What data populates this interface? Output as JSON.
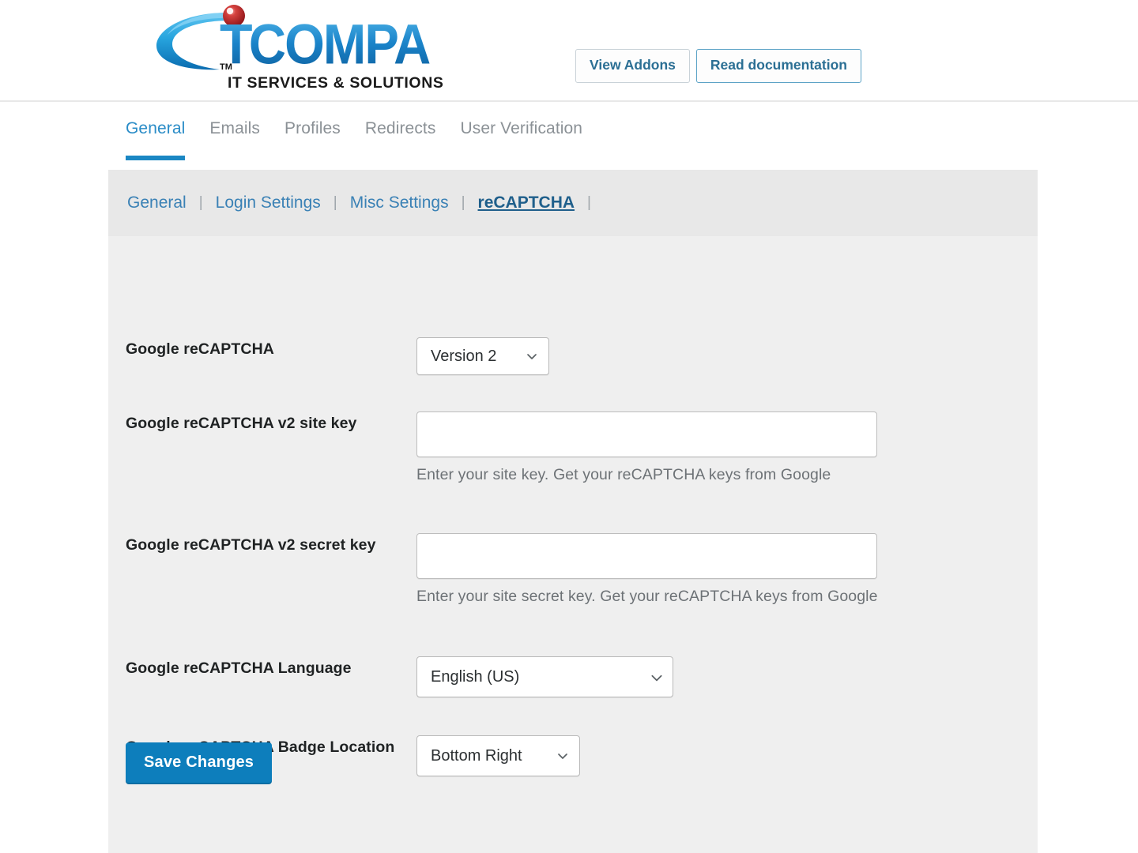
{
  "header": {
    "logo": {
      "name": "IT COMPANY",
      "letter_i": "I",
      "word_t": "T",
      "word_company": "COMPANY",
      "trademark": "TM",
      "tagline": "IT SERVICES & SOLUTIONS",
      "swoosh_color": "#1f9ad6",
      "sphere_color": "#c1272d",
      "text_color": "#1475bb"
    },
    "buttons": [
      {
        "label": "View Addons",
        "style": "gray"
      },
      {
        "label": "Read documentation",
        "style": "blue"
      }
    ]
  },
  "tabs": [
    {
      "label": "General",
      "active": true
    },
    {
      "label": "Emails",
      "active": false
    },
    {
      "label": "Profiles",
      "active": false
    },
    {
      "label": "Redirects",
      "active": false
    },
    {
      "label": "User Verification",
      "active": false
    }
  ],
  "subnav": {
    "items": [
      {
        "label": "General",
        "active": false
      },
      {
        "label": "Login Settings",
        "active": false
      },
      {
        "label": "Misc Settings",
        "active": false
      },
      {
        "label": "reCAPTCHA",
        "active": true
      }
    ],
    "separator": "|"
  },
  "form": {
    "recaptcha_version": {
      "label": "Google reCAPTCHA",
      "value": "Version 2",
      "caret": "chevron-down-icon"
    },
    "site_key": {
      "label": "Google reCAPTCHA v2 site key",
      "value": "",
      "placeholder": "",
      "helper": "Enter your site key. Get your reCAPTCHA keys from Google"
    },
    "secret_key": {
      "label": "Google reCAPTCHA v2 secret key",
      "value": "",
      "placeholder": "",
      "helper": "Enter your site secret key. Get your reCAPTCHA keys from Google"
    },
    "language": {
      "label": "Google reCAPTCHA Language",
      "value": "English (US)",
      "caret": "chevron-down-icon"
    },
    "badge_location": {
      "label": "Google reCAPTCHA Badge Location",
      "value": "Bottom Right",
      "caret": "chevron-down-icon"
    },
    "save_label": "Save Changes"
  },
  "colors": {
    "accent_blue": "#1b87c3",
    "save_button": "#0d7ebc",
    "panel_bg": "#efefef",
    "subnav_bg": "#e8e8e8",
    "link_blue": "#3a81b5"
  }
}
